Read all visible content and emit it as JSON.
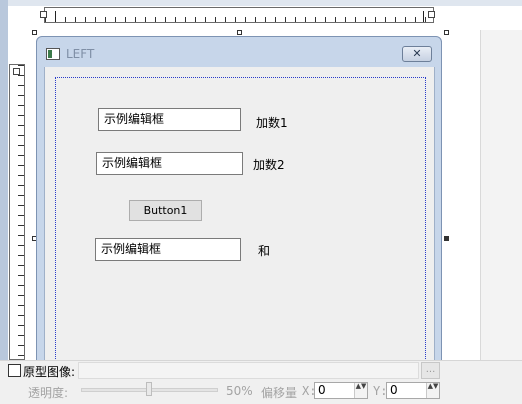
{
  "form": {
    "title": "LEFT",
    "close_glyph": "✕"
  },
  "controls": {
    "textbox1": "示例编辑框",
    "textbox2": "示例编辑框",
    "textbox3": "示例编辑框",
    "label1": "加数1",
    "label2": "加数2",
    "label3": "和",
    "button1": "Button1"
  },
  "bottom": {
    "prototype_label": "原型图像:",
    "browse_label": "...",
    "opacity_label": "透明度:",
    "opacity_value": "50%",
    "offset_label": "偏移量",
    "x_label": "X:",
    "x_value": "0",
    "y_label": "Y:",
    "y_value": "0",
    "spin_glyph": "▲▼"
  },
  "icons": [
    "window-app-icon",
    "close-icon",
    "checkbox-icon",
    "spin-arrows-icon"
  ],
  "colors": {
    "accent": "#2a3cc9",
    "window_frame": "#c7d6ea",
    "client_bg": "#efefef"
  }
}
